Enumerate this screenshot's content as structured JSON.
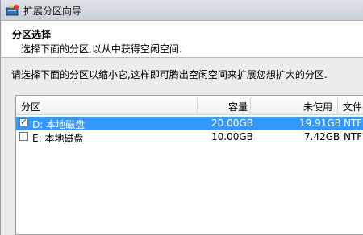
{
  "window": {
    "title": "扩展分区向导"
  },
  "header": {
    "title": "分区选择",
    "subtitle": "选择下面的分区,以从中获得空闲空间."
  },
  "instruction": "请选择下面的分区以缩小它,这样即可腾出空闲空间来扩展您想扩大的分区.",
  "table": {
    "columns": {
      "partition": "分区",
      "capacity": "容量",
      "unused": "未使用",
      "filesystem": "文件"
    },
    "rows": [
      {
        "checked": true,
        "selected": true,
        "partition": "D: 本地磁盘",
        "capacity": "20.00GB",
        "unused": "19.91GB",
        "filesystem": "NTFS"
      },
      {
        "checked": false,
        "selected": false,
        "partition": "E: 本地磁盘",
        "capacity": "10.00GB",
        "unused": "7.42GB",
        "filesystem": "NTFS"
      }
    ]
  },
  "colors": {
    "selection": "#3399ff"
  }
}
